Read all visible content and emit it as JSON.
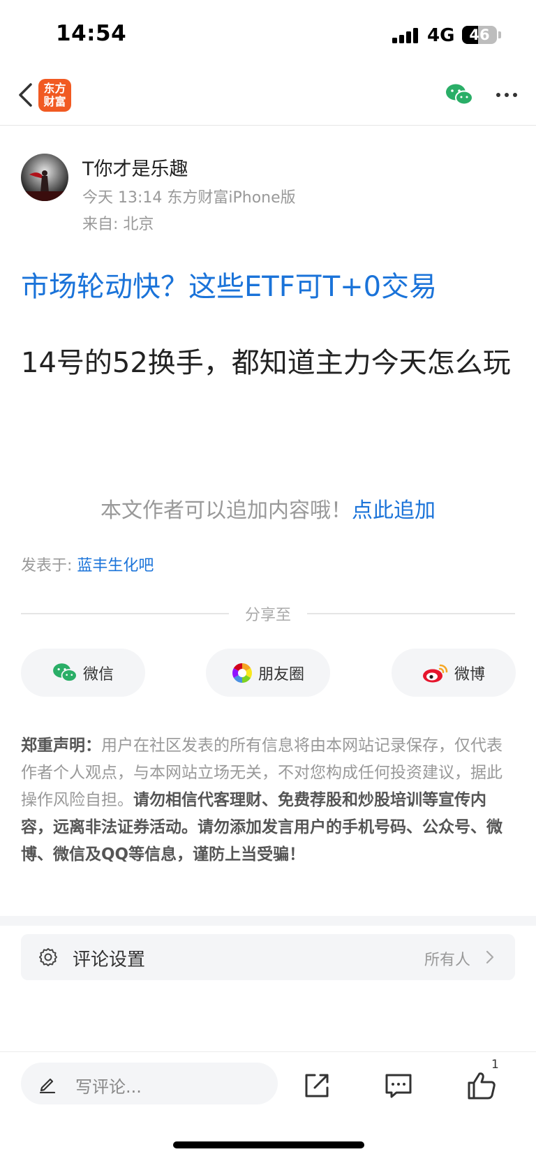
{
  "status_bar": {
    "time": "14:54",
    "network": "4G",
    "battery_level": "46",
    "battery_fraction": 0.46
  },
  "nav": {
    "back_icon": "chevron-left-icon",
    "logo_line1": "东方",
    "logo_line2": "财富",
    "logo_color": "#f15a22",
    "wechat_icon": "wechat-icon",
    "more_icon": "more-horizontal-icon"
  },
  "post": {
    "author_name": "T你才是乐趣",
    "meta": "今天 13:14 东方财富iPhone版",
    "location": "来自: 北京",
    "title": "市场轮动快？这些ETF可T+0交易",
    "body": "14号的52换手，都知道主力今天怎么玩",
    "append_hint": "本文作者可以追加内容哦！",
    "append_link": "点此追加",
    "posted_in_label": "发表于: ",
    "posted_in_bar": "蓝丰生化吧"
  },
  "share": {
    "label": "分享至",
    "buttons": [
      {
        "label": "微信",
        "icon": "wechat-icon"
      },
      {
        "label": "朋友圈",
        "icon": "moments-icon"
      },
      {
        "label": "微博",
        "icon": "weibo-icon"
      }
    ]
  },
  "disclaimer": {
    "title": "郑重声明：",
    "text": "用户在社区发表的所有信息将由本网站记录保存，仅代表作者个人观点，与本网站立场无关，不对您构成任何投资建议，据此操作风险自担。",
    "bold_text": "请勿相信代客理财、免费荐股和炒股培训等宣传内容，远离非法证券活动。请勿添加发言用户的手机号码、公众号、微博、微信及QQ等信息，谨防上当受骗！"
  },
  "comment_settings": {
    "icon": "gear-icon",
    "label": "评论设置",
    "value": "所有人"
  },
  "bottom_bar": {
    "comment_placeholder": "写评论...",
    "like_count": "1"
  },
  "colors": {
    "link_blue": "#1a73d9",
    "wechat_green": "#2aae67",
    "weibo_red": "#e6162d"
  }
}
